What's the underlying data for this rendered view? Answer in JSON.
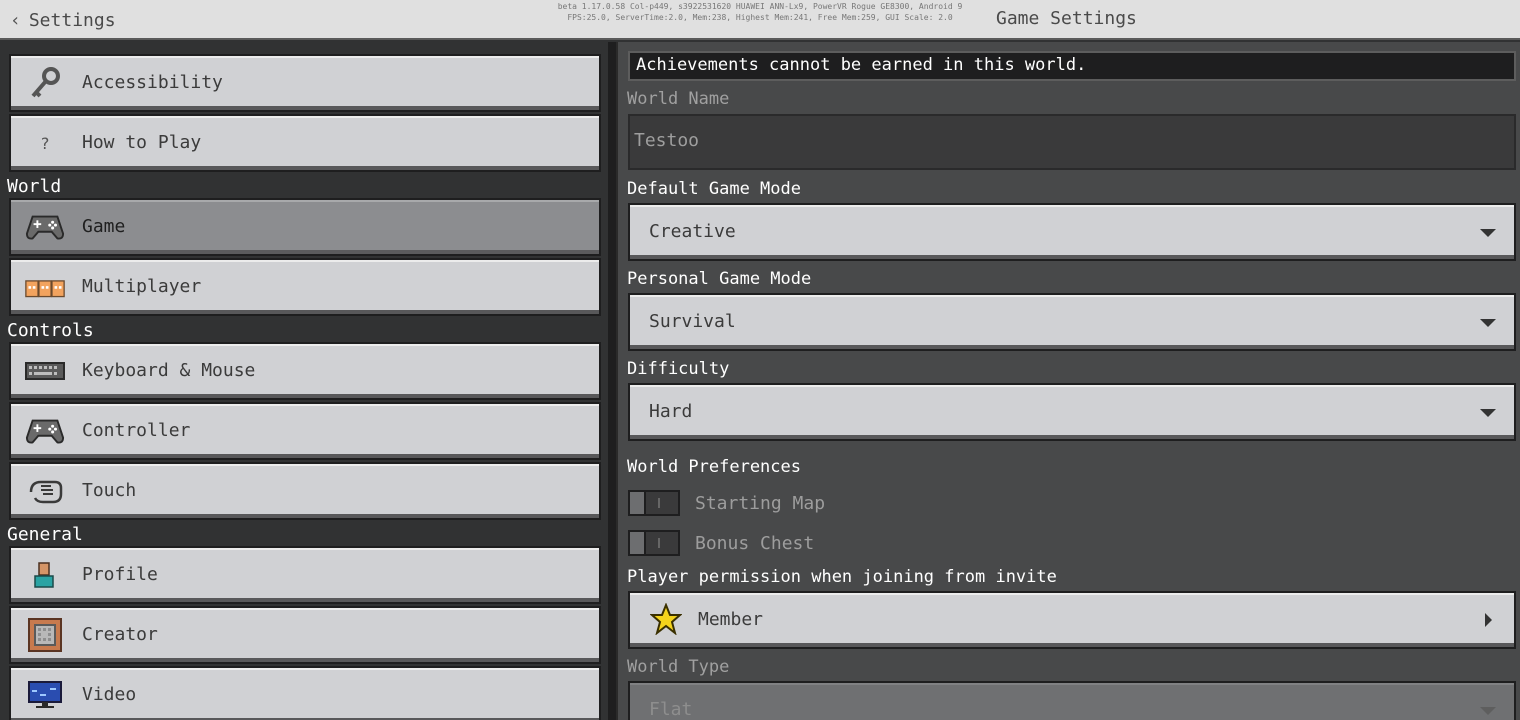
{
  "topbar": {
    "back_label": "Settings",
    "debug_line1": "beta 1.17.0.58 Col-p449, s3922531620 HUAWEI ANN-Lx9, PowerVR Rogue GE8300, Android 9",
    "debug_line2": "FPS:25.0, ServerTime:2.0, Mem:238, Highest Mem:241, Free Mem:259, GUI Scale: 2.0",
    "title": "Game Settings"
  },
  "sidebar": {
    "items": [
      {
        "label": "Accessibility",
        "icon": "key-icon"
      },
      {
        "label": "How to Play",
        "icon": "question-icon"
      },
      {
        "label": "Game",
        "icon": "gamepad-icon"
      },
      {
        "label": "Multiplayer",
        "icon": "players-icon"
      },
      {
        "label": "Keyboard & Mouse",
        "icon": "keyboard-icon"
      },
      {
        "label": "Controller",
        "icon": "controller-icon"
      },
      {
        "label": "Touch",
        "icon": "touch-icon"
      },
      {
        "label": "Profile",
        "icon": "profile-icon"
      },
      {
        "label": "Creator",
        "icon": "creator-icon"
      },
      {
        "label": "Video",
        "icon": "monitor-icon"
      }
    ],
    "sections": {
      "world": "World",
      "controls": "Controls",
      "general": "General"
    },
    "active": "Game"
  },
  "main": {
    "notice": "Achievements cannot be earned in this world.",
    "world_name": {
      "label": "World Name",
      "value": "Testoo"
    },
    "default_game_mode": {
      "label": "Default Game Mode",
      "value": "Creative"
    },
    "personal_game_mode": {
      "label": "Personal Game Mode",
      "value": "Survival"
    },
    "difficulty": {
      "label": "Difficulty",
      "value": "Hard"
    },
    "world_preferences": {
      "label": "World Preferences",
      "starting_map": "Starting Map",
      "bonus_chest": "Bonus Chest"
    },
    "player_permission": {
      "label": "Player permission when joining from invite",
      "value": "Member"
    },
    "world_type": {
      "label": "World Type",
      "value": "Flat"
    }
  },
  "colors": {
    "accent_star": "#f4d31c",
    "background": "#313233",
    "panel": "#48494a",
    "button": "#d0d1d4"
  }
}
